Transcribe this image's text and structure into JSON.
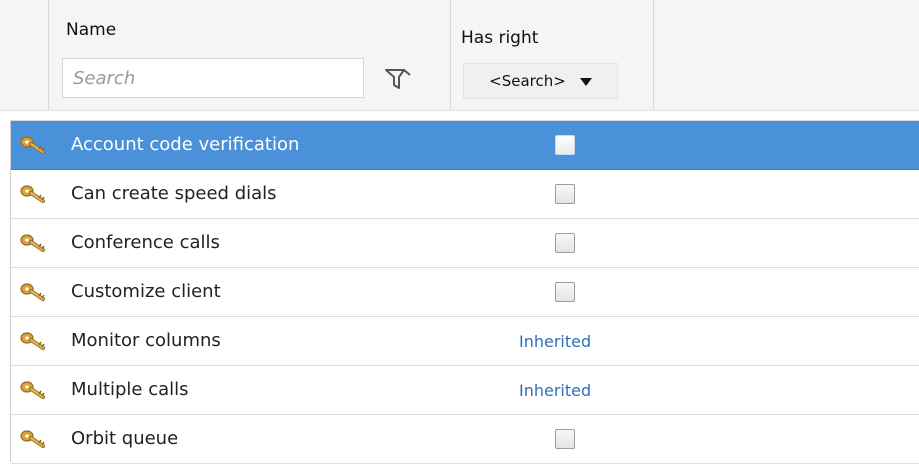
{
  "header": {
    "name_label": "Name",
    "search_placeholder": "Search",
    "has_right_label": "Has right",
    "has_right_selected": "<Search>"
  },
  "rows": [
    {
      "label": "Account code verification",
      "value": "checkbox",
      "checked": false,
      "selected": true
    },
    {
      "label": "Can create speed dials",
      "value": "checkbox",
      "checked": false
    },
    {
      "label": "Conference calls",
      "value": "checkbox",
      "checked": false
    },
    {
      "label": "Customize client",
      "value": "checkbox",
      "checked": false
    },
    {
      "label": "Monitor columns",
      "value": "Inherited"
    },
    {
      "label": "Multiple calls",
      "value": "Inherited"
    },
    {
      "label": "Orbit queue",
      "value": "checkbox",
      "checked": false
    }
  ],
  "icons": {
    "row_icon": "key-icon",
    "filter_icon": "filter-icon",
    "dropdown_icon": "chevron-down-icon"
  },
  "colors": {
    "selection": "#4b91d9",
    "inherited_link": "#2f6fb8"
  }
}
